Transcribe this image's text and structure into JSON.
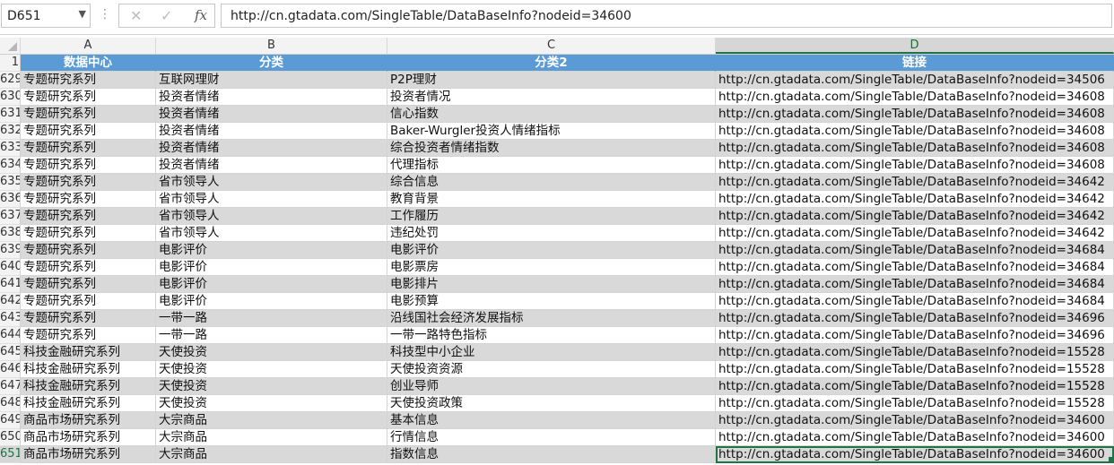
{
  "name_box": {
    "value": "D651"
  },
  "formula_bar": {
    "cancel_icon": "✕",
    "enter_icon": "✓",
    "fx_label": "fx",
    "formula": "http://cn.gtadata.com/SingleTable/DataBaseInfo?nodeid=34600"
  },
  "columns": [
    {
      "label": "A"
    },
    {
      "label": "B"
    },
    {
      "label": "C"
    },
    {
      "label": "D",
      "selected": true
    }
  ],
  "header_row": {
    "row": "1",
    "cells": [
      "数据中心",
      "分类",
      "分类2",
      "链接"
    ]
  },
  "rows": [
    {
      "row": "629",
      "a": "专题研究系列",
      "b": "互联网理财",
      "c": "P2P理财",
      "d": "http://cn.gtadata.com/SingleTable/DataBaseInfo?nodeid=34506"
    },
    {
      "row": "630",
      "a": "专题研究系列",
      "b": "投资者情绪",
      "c": "投资者情况",
      "d": "http://cn.gtadata.com/SingleTable/DataBaseInfo?nodeid=34608"
    },
    {
      "row": "631",
      "a": "专题研究系列",
      "b": "投资者情绪",
      "c": "信心指数",
      "d": "http://cn.gtadata.com/SingleTable/DataBaseInfo?nodeid=34608"
    },
    {
      "row": "632",
      "a": "专题研究系列",
      "b": "投资者情绪",
      "c": "Baker-Wurgler投资人情绪指标",
      "d": "http://cn.gtadata.com/SingleTable/DataBaseInfo?nodeid=34608"
    },
    {
      "row": "633",
      "a": "专题研究系列",
      "b": "投资者情绪",
      "c": "综合投资者情绪指数",
      "d": "http://cn.gtadata.com/SingleTable/DataBaseInfo?nodeid=34608"
    },
    {
      "row": "634",
      "a": "专题研究系列",
      "b": "投资者情绪",
      "c": "代理指标",
      "d": "http://cn.gtadata.com/SingleTable/DataBaseInfo?nodeid=34608"
    },
    {
      "row": "635",
      "a": "专题研究系列",
      "b": "省市领导人",
      "c": "综合信息",
      "d": "http://cn.gtadata.com/SingleTable/DataBaseInfo?nodeid=34642"
    },
    {
      "row": "636",
      "a": "专题研究系列",
      "b": "省市领导人",
      "c": "教育背景",
      "d": "http://cn.gtadata.com/SingleTable/DataBaseInfo?nodeid=34642"
    },
    {
      "row": "637",
      "a": "专题研究系列",
      "b": "省市领导人",
      "c": "工作履历",
      "d": "http://cn.gtadata.com/SingleTable/DataBaseInfo?nodeid=34642"
    },
    {
      "row": "638",
      "a": "专题研究系列",
      "b": "省市领导人",
      "c": "违纪处罚",
      "d": "http://cn.gtadata.com/SingleTable/DataBaseInfo?nodeid=34642"
    },
    {
      "row": "639",
      "a": "专题研究系列",
      "b": "电影评价",
      "c": "电影评价",
      "d": "http://cn.gtadata.com/SingleTable/DataBaseInfo?nodeid=34684"
    },
    {
      "row": "640",
      "a": "专题研究系列",
      "b": "电影评价",
      "c": "电影票房",
      "d": "http://cn.gtadata.com/SingleTable/DataBaseInfo?nodeid=34684"
    },
    {
      "row": "641",
      "a": "专题研究系列",
      "b": "电影评价",
      "c": "电影排片",
      "d": "http://cn.gtadata.com/SingleTable/DataBaseInfo?nodeid=34684"
    },
    {
      "row": "642",
      "a": "专题研究系列",
      "b": "电影评价",
      "c": "电影预算",
      "d": "http://cn.gtadata.com/SingleTable/DataBaseInfo?nodeid=34684"
    },
    {
      "row": "643",
      "a": "专题研究系列",
      "b": "一带一路",
      "c": "沿线国社会经济发展指标",
      "d": "http://cn.gtadata.com/SingleTable/DataBaseInfo?nodeid=34696"
    },
    {
      "row": "644",
      "a": "专题研究系列",
      "b": "一带一路",
      "c": "一带一路特色指标",
      "d": "http://cn.gtadata.com/SingleTable/DataBaseInfo?nodeid=34696"
    },
    {
      "row": "645",
      "a": "科技金融研究系列",
      "b": "天使投资",
      "c": "科技型中小企业",
      "d": "http://cn.gtadata.com/SingleTable/DataBaseInfo?nodeid=15528"
    },
    {
      "row": "646",
      "a": "科技金融研究系列",
      "b": "天使投资",
      "c": "天使投资资源",
      "d": "http://cn.gtadata.com/SingleTable/DataBaseInfo?nodeid=15528"
    },
    {
      "row": "647",
      "a": "科技金融研究系列",
      "b": "天使投资",
      "c": "创业导师",
      "d": "http://cn.gtadata.com/SingleTable/DataBaseInfo?nodeid=15528"
    },
    {
      "row": "648",
      "a": "科技金融研究系列",
      "b": "天使投资",
      "c": "天使投资政策",
      "d": "http://cn.gtadata.com/SingleTable/DataBaseInfo?nodeid=15528"
    },
    {
      "row": "649",
      "a": "商品市场研究系列",
      "b": "大宗商品",
      "c": "基本信息",
      "d": "http://cn.gtadata.com/SingleTable/DataBaseInfo?nodeid=34600"
    },
    {
      "row": "650",
      "a": "商品市场研究系列",
      "b": "大宗商品",
      "c": "行情信息",
      "d": "http://cn.gtadata.com/SingleTable/DataBaseInfo?nodeid=34600"
    },
    {
      "row": "651",
      "a": "商品市场研究系列",
      "b": "大宗商品",
      "c": "指数信息",
      "d": "http://cn.gtadata.com/SingleTable/DataBaseInfo?nodeid=34600",
      "selected": true
    }
  ],
  "colors": {
    "header_fill": "#5b9bd5",
    "band_fill": "#d9d9d9",
    "selection": "#217346"
  }
}
